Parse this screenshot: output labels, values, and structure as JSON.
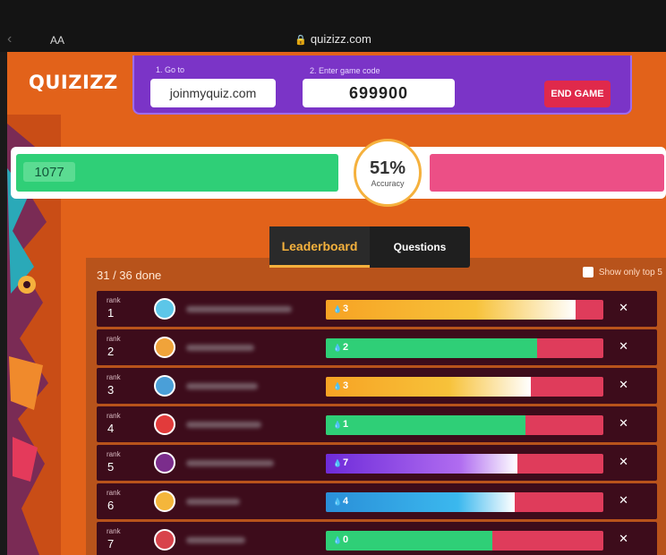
{
  "browser": {
    "text_size_button": "AA",
    "url": "quizizz.com"
  },
  "app": {
    "logo": "QUIZIZZ"
  },
  "join": {
    "step1_label": "1. Go to",
    "join_url": "joinmyquiz.com",
    "step2_label": "2. Enter game code",
    "game_code": "699900",
    "end_game_label": "END GAME"
  },
  "accuracy": {
    "correct_count": "1077",
    "percent": "51%",
    "label": "Accuracy",
    "correct_fraction": 0.51
  },
  "tabs": {
    "leaderboard": "Leaderboard",
    "questions": "Questions",
    "active": "Leaderboard"
  },
  "progress": {
    "done_text": "31 / 36 done"
  },
  "filter": {
    "top5_label": "Show only top 5",
    "checked": false
  },
  "rank_label": "rank",
  "colors": {
    "orange_bg": "#e2621a",
    "purple_panel": "#7b34c7",
    "correct_green": "#2fcf77",
    "incorrect_pink": "#ec4f86",
    "accent_yellow": "#f5b13d"
  },
  "leaderboard": [
    {
      "rank": "1",
      "streak": "3",
      "progress": 0.9,
      "fill": "linear-gradient(90deg,#f7a324,#f7c23a 60%,#ffffff)",
      "avatar": "#5cc6e8",
      "name_width": 118
    },
    {
      "rank": "2",
      "streak": "2",
      "progress": 0.76,
      "fill": "#2fcf77",
      "avatar": "#f0a33a",
      "name_width": 76
    },
    {
      "rank": "3",
      "streak": "3",
      "progress": 0.74,
      "fill": "linear-gradient(90deg,#f7a324,#f7c23a 60%,#ffffff)",
      "avatar": "#4a9fd8",
      "name_width": 80
    },
    {
      "rank": "4",
      "streak": "1",
      "progress": 0.72,
      "fill": "#2fcf77",
      "avatar": "#e23b3b",
      "name_width": 84
    },
    {
      "rank": "5",
      "streak": "7",
      "progress": 0.69,
      "fill": "linear-gradient(90deg,#6e2bd9,#b06cf0 70%,#ffffff)",
      "avatar": "#7b2d8c",
      "name_width": 98
    },
    {
      "rank": "6",
      "streak": "4",
      "progress": 0.68,
      "fill": "linear-gradient(90deg,#2a8fd8,#3bb8ee 70%,#ffffff)",
      "avatar": "#f4b63b",
      "name_width": 60
    },
    {
      "rank": "7",
      "streak": "0",
      "progress": 0.6,
      "fill": "#2fcf77",
      "avatar": "#d8434b",
      "name_width": 66
    }
  ]
}
